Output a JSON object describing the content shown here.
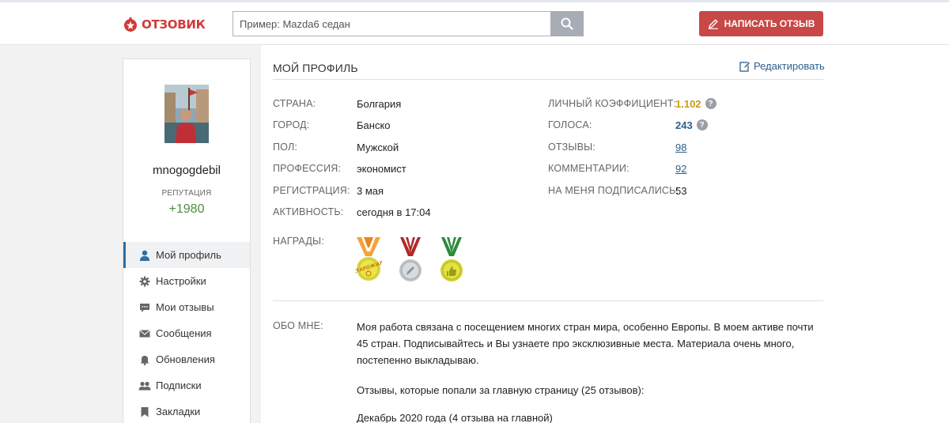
{
  "header": {
    "logo_text": "ОТЗОВИК",
    "search_placeholder": "Пример: Mazda6 седан",
    "write_review_label": "НАПИСАТЬ ОТЗЫВ",
    "brand_color": "#c84747"
  },
  "sidebar": {
    "username": "mnogogdebil",
    "reputation_label": "РЕПУТАЦИЯ",
    "reputation_value": "+1980",
    "menu": [
      {
        "label": "Мой профиль",
        "icon": "user-icon",
        "active": true
      },
      {
        "label": "Настройки",
        "icon": "gear-icon",
        "active": false
      },
      {
        "label": "Мои отзывы",
        "icon": "chat-icon",
        "active": false
      },
      {
        "label": "Сообщения",
        "icon": "envelope-icon",
        "active": false
      },
      {
        "label": "Обновления",
        "icon": "bell-icon",
        "active": false
      },
      {
        "label": "Подписки",
        "icon": "users-icon",
        "active": false
      },
      {
        "label": "Закладки",
        "icon": "bookmark-icon",
        "active": false
      }
    ]
  },
  "profile": {
    "title": "МОЙ ПРОФИЛЬ",
    "edit_label": "Редактировать",
    "left_fields": [
      {
        "label": "СТРАНА:",
        "value": "Болгария"
      },
      {
        "label": "ГОРОД:",
        "value": "Банско"
      },
      {
        "label": "ПОЛ:",
        "value": "Мужской"
      },
      {
        "label": "ПРОФЕССИЯ:",
        "value": "экономист"
      },
      {
        "label": "РЕГИСТРАЦИЯ:",
        "value": "3 мая"
      },
      {
        "label": "АКТИВНОСТЬ:",
        "value": "сегодня в 17:04"
      }
    ],
    "right_fields": [
      {
        "label": "ЛИЧНЫЙ КОЭФФИЦИЕНТ:",
        "value": "1.102"
      },
      {
        "label": "ГОЛОСА:",
        "value": "243"
      },
      {
        "label": "ОТЗЫВЫ:",
        "value": "98"
      },
      {
        "label": "КОММЕНТАРИИ:",
        "value": "92"
      },
      {
        "label": "НА МЕНЯ ПОДПИСАЛИСЬ:",
        "value": "53"
      }
    ],
    "awards_label": "НАГРАДЫ:",
    "awards": [
      {
        "icon": "medal-veteran-icon",
        "text": "СТАРОЖИЛ"
      },
      {
        "icon": "medal-writer-icon"
      },
      {
        "icon": "medal-thumbs-up-icon"
      }
    ],
    "about_label": "ОБО МНЕ:",
    "about_text": "Моя работа связана с посещением многих стран мира, особенно Европы. В моем активе почти 45 стран. Подписывайтесь и Вы узнаете про эксклюзивные места. Материала очень много, постепенно выкладываю.",
    "about_line2": "Отзывы, которые попали за главную страницу (25 отзывов):",
    "about_line3": "Декабрь 2020 года (4 отзыва на главной)"
  }
}
